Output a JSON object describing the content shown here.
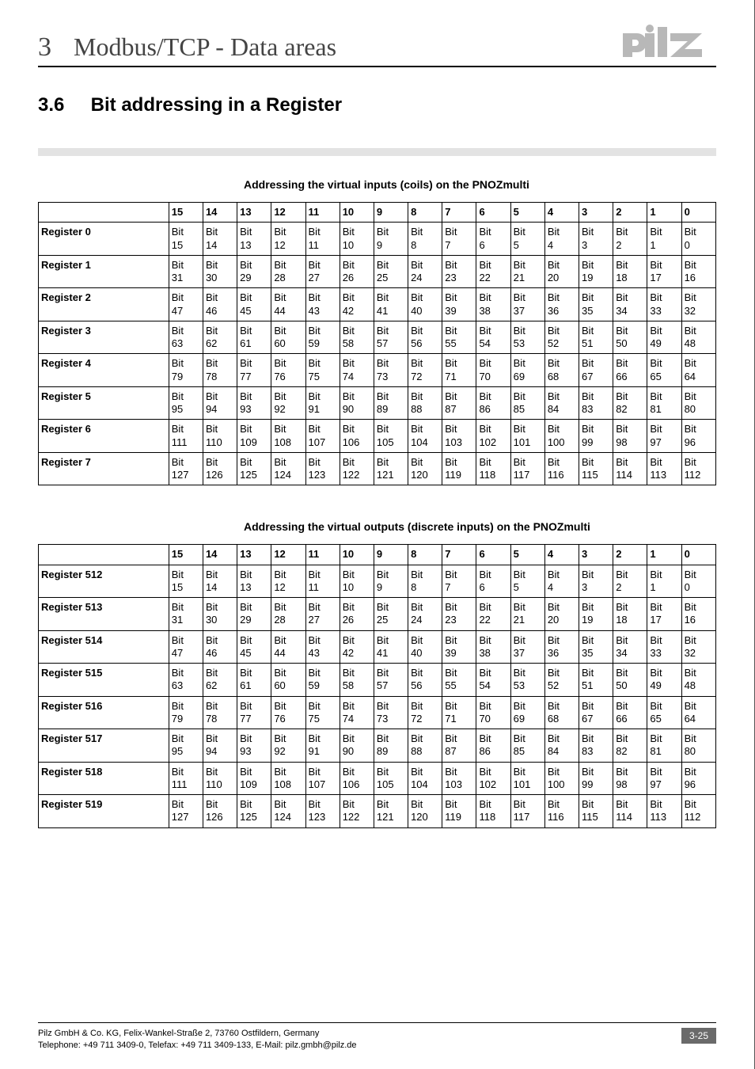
{
  "header": {
    "chapter_number": "3",
    "chapter_title": "Modbus/TCP - Data areas"
  },
  "section": {
    "number": "3.6",
    "title": "Bit addressing in a Register"
  },
  "tables": [
    {
      "caption": "Addressing the virtual inputs (coils) on the PNOZmulti",
      "columns": [
        "15",
        "14",
        "13",
        "12",
        "11",
        "10",
        "9",
        "8",
        "7",
        "6",
        "5",
        "4",
        "3",
        "2",
        "1",
        "0"
      ],
      "rows": [
        {
          "label": "Register 0",
          "cells": [
            "Bit 15",
            "Bit 14",
            "Bit 13",
            "Bit 12",
            "Bit 11",
            "Bit 10",
            "Bit 9",
            "Bit 8",
            "Bit 7",
            "Bit 6",
            "Bit 5",
            "Bit 4",
            "Bit 3",
            "Bit 2",
            "Bit 1",
            "Bit 0"
          ]
        },
        {
          "label": "Register 1",
          "cells": [
            "Bit 31",
            "Bit 30",
            "Bit 29",
            "Bit 28",
            "Bit 27",
            "Bit 26",
            "Bit 25",
            "Bit 24",
            "Bit 23",
            "Bit 22",
            "Bit 21",
            "Bit 20",
            "Bit 19",
            "Bit 18",
            "Bit 17",
            "Bit 16"
          ]
        },
        {
          "label": "Register 2",
          "cells": [
            "Bit 47",
            "Bit 46",
            "Bit 45",
            "Bit 44",
            "Bit 43",
            "Bit 42",
            "Bit 41",
            "Bit 40",
            "Bit 39",
            "Bit 38",
            "Bit 37",
            "Bit 36",
            "Bit 35",
            "Bit 34",
            "Bit 33",
            "Bit 32"
          ]
        },
        {
          "label": "Register 3",
          "cells": [
            "Bit 63",
            "Bit 62",
            "Bit 61",
            "Bit 60",
            "Bit 59",
            "Bit 58",
            "Bit 57",
            "Bit 56",
            "Bit 55",
            "Bit 54",
            "Bit 53",
            "Bit 52",
            "Bit 51",
            "Bit 50",
            "Bit 49",
            "Bit 48"
          ]
        },
        {
          "label": "Register 4",
          "cells": [
            "Bit 79",
            "Bit 78",
            "Bit 77",
            "Bit 76",
            "Bit 75",
            "Bit 74",
            "Bit 73",
            "Bit 72",
            "Bit 71",
            "Bit 70",
            "Bit 69",
            "Bit 68",
            "Bit 67",
            "Bit 66",
            "Bit 65",
            "Bit 64"
          ]
        },
        {
          "label": "Register 5",
          "cells": [
            "Bit 95",
            "Bit 94",
            "Bit 93",
            "Bit 92",
            "Bit 91",
            "Bit 90",
            "Bit 89",
            "Bit 88",
            "Bit 87",
            "Bit 86",
            "Bit 85",
            "Bit 84",
            "Bit 83",
            "Bit 82",
            "Bit 81",
            "Bit 80"
          ]
        },
        {
          "label": "Register 6",
          "cells": [
            "Bit 111",
            "Bit 110",
            "Bit 109",
            "Bit 108",
            "Bit 107",
            "Bit 106",
            "Bit 105",
            "Bit 104",
            "Bit 103",
            "Bit 102",
            "Bit 101",
            "Bit 100",
            "Bit 99",
            "Bit 98",
            "Bit 97",
            "Bit 96"
          ]
        },
        {
          "label": "Register 7",
          "cells": [
            "Bit 127",
            "Bit 126",
            "Bit 125",
            "Bit 124",
            "Bit 123",
            "Bit 122",
            "Bit 121",
            "Bit 120",
            "Bit 119",
            "Bit 118",
            "Bit 117",
            "Bit 116",
            "Bit 115",
            "Bit 114",
            "Bit 113",
            "Bit 112"
          ]
        }
      ]
    },
    {
      "caption": "Addressing the virtual outputs (discrete inputs) on the PNOZmulti",
      "columns": [
        "15",
        "14",
        "13",
        "12",
        "11",
        "10",
        "9",
        "8",
        "7",
        "6",
        "5",
        "4",
        "3",
        "2",
        "1",
        "0"
      ],
      "rows": [
        {
          "label": "Register 512",
          "cells": [
            "Bit 15",
            "Bit 14",
            "Bit 13",
            "Bit 12",
            "Bit 11",
            "Bit 10",
            "Bit 9",
            "Bit 8",
            "Bit 7",
            "Bit 6",
            "Bit 5",
            "Bit 4",
            "Bit 3",
            "Bit 2",
            "Bit 1",
            "Bit 0"
          ]
        },
        {
          "label": "Register 513",
          "cells": [
            "Bit 31",
            "Bit 30",
            "Bit 29",
            "Bit 28",
            "Bit 27",
            "Bit 26",
            "Bit 25",
            "Bit 24",
            "Bit 23",
            "Bit 22",
            "Bit 21",
            "Bit 20",
            "Bit 19",
            "Bit 18",
            "Bit 17",
            "Bit 16"
          ]
        },
        {
          "label": "Register 514",
          "cells": [
            "Bit 47",
            "Bit 46",
            "Bit 45",
            "Bit 44",
            "Bit 43",
            "Bit 42",
            "Bit 41",
            "Bit 40",
            "Bit 39",
            "Bit 38",
            "Bit 37",
            "Bit 36",
            "Bit 35",
            "Bit 34",
            "Bit 33",
            "Bit 32"
          ]
        },
        {
          "label": "Register 515",
          "cells": [
            "Bit 63",
            "Bit 62",
            "Bit 61",
            "Bit 60",
            "Bit 59",
            "Bit 58",
            "Bit 57",
            "Bit 56",
            "Bit 55",
            "Bit 54",
            "Bit 53",
            "Bit 52",
            "Bit 51",
            "Bit 50",
            "Bit 49",
            "Bit 48"
          ]
        },
        {
          "label": "Register 516",
          "cells": [
            "Bit 79",
            "Bit 78",
            "Bit 77",
            "Bit 76",
            "Bit 75",
            "Bit 74",
            "Bit 73",
            "Bit 72",
            "Bit 71",
            "Bit 70",
            "Bit 69",
            "Bit 68",
            "Bit 67",
            "Bit 66",
            "Bit 65",
            "Bit 64"
          ]
        },
        {
          "label": "Register 517",
          "cells": [
            "Bit 95",
            "Bit 94",
            "Bit 93",
            "Bit 92",
            "Bit 91",
            "Bit 90",
            "Bit 89",
            "Bit 88",
            "Bit 87",
            "Bit 86",
            "Bit 85",
            "Bit 84",
            "Bit 83",
            "Bit 82",
            "Bit 81",
            "Bit 80"
          ]
        },
        {
          "label": "Register 518",
          "cells": [
            "Bit 111",
            "Bit 110",
            "Bit 109",
            "Bit 108",
            "Bit 107",
            "Bit 106",
            "Bit 105",
            "Bit 104",
            "Bit 103",
            "Bit 102",
            "Bit 101",
            "Bit 100",
            "Bit 99",
            "Bit 98",
            "Bit 97",
            "Bit 96"
          ]
        },
        {
          "label": "Register 519",
          "cells": [
            "Bit 127",
            "Bit 126",
            "Bit 125",
            "Bit 124",
            "Bit 123",
            "Bit 122",
            "Bit 121",
            "Bit 120",
            "Bit 119",
            "Bit 118",
            "Bit 117",
            "Bit 116",
            "Bit 115",
            "Bit 114",
            "Bit 113",
            "Bit 112"
          ]
        }
      ]
    }
  ],
  "footer": {
    "line1": "Pilz GmbH & Co. KG, Felix-Wankel-Straße 2, 73760 Ostfildern, Germany",
    "line2": "Telephone: +49 711 3409-0, Telefax: +49 711 3409-133, E-Mail: pilz.gmbh@pilz.de",
    "page": "3-25"
  }
}
